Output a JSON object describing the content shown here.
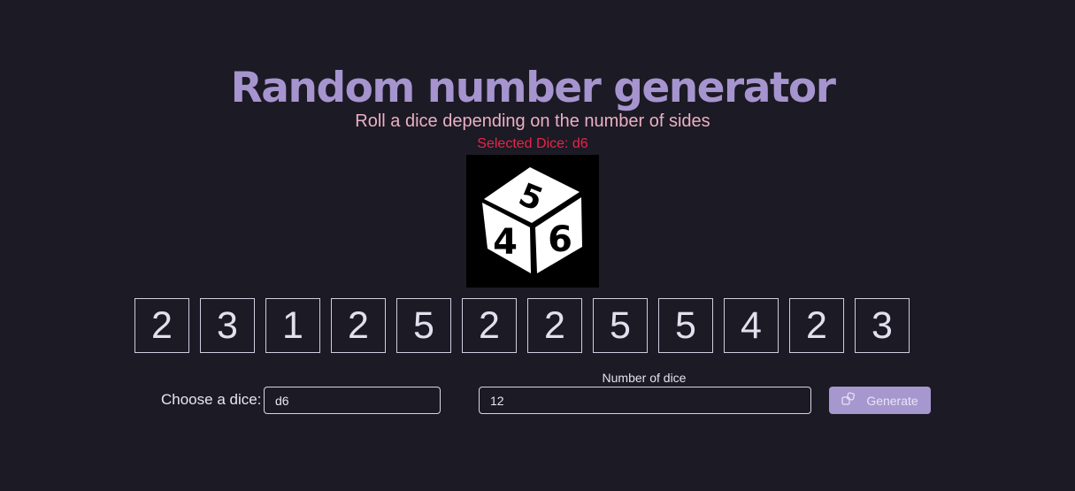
{
  "header": {
    "title": "Random number generator",
    "subtitle": "Roll a dice depending on the number of sides",
    "selected_dice": "Selected Dice: d6"
  },
  "dice_image": {
    "icon": "d6-die-icon",
    "faces": [
      "5",
      "4",
      "6"
    ]
  },
  "results": [
    "2",
    "3",
    "1",
    "2",
    "5",
    "2",
    "2",
    "5",
    "5",
    "4",
    "2",
    "3"
  ],
  "controls": {
    "choose_label": "Choose a dice:",
    "dice_value": "d6",
    "number_label": "Number of dice",
    "number_value": "12",
    "generate_label": "Generate",
    "generate_icon": "dice-icon"
  },
  "colors": {
    "background": "#1c1a24",
    "title": "#a694cf",
    "subtitle": "#e9b0c4",
    "selected": "#e8244a",
    "button": "#a797cf"
  }
}
